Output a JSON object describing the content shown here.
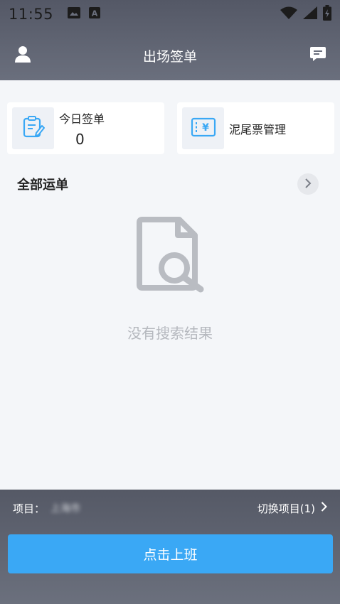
{
  "status_bar": {
    "time": "11:55",
    "left_icons": [
      "image-icon",
      "a-icon"
    ],
    "right_icons": [
      "wifi-icon",
      "signal-icon",
      "battery-icon"
    ]
  },
  "header": {
    "title": "出场签单",
    "left_icon": "user-icon",
    "right_icon": "message-icon"
  },
  "cards": {
    "today": {
      "label": "今日签单",
      "count": "0",
      "icon": "edit-clipboard-icon"
    },
    "mud": {
      "label": "泥尾票管理",
      "icon": "ticket-yen-icon"
    }
  },
  "section": {
    "title": "全部运单",
    "arrow_icon": "chevron-right-icon"
  },
  "empty_state": {
    "icon": "document-search-icon",
    "text": "没有搜索结果"
  },
  "footer": {
    "project_label": "项目：",
    "project_value": "上海市",
    "switch_label": "切换项目(1)",
    "switch_icon": "chevron-right-icon",
    "clock_in_label": "点击上班"
  },
  "colors": {
    "header_bg": "#545866",
    "accent": "#3aa8f5",
    "page_bg": "#f4f6f9",
    "icon_blue": "#3aa8f5",
    "empty_gray": "#b5b8be"
  }
}
